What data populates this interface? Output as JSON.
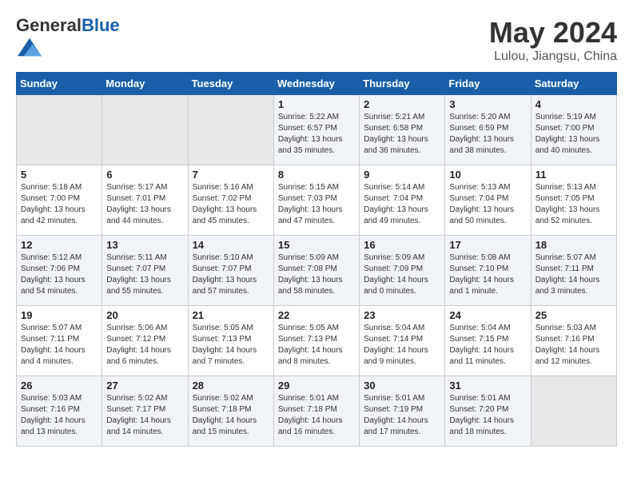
{
  "header": {
    "logo_general": "General",
    "logo_blue": "Blue",
    "month_title": "May 2024",
    "location": "Lulou, Jiangsu, China"
  },
  "weekdays": [
    "Sunday",
    "Monday",
    "Tuesday",
    "Wednesday",
    "Thursday",
    "Friday",
    "Saturday"
  ],
  "weeks": [
    [
      {
        "day": "",
        "info": ""
      },
      {
        "day": "",
        "info": ""
      },
      {
        "day": "",
        "info": ""
      },
      {
        "day": "1",
        "info": "Sunrise: 5:22 AM\nSunset: 6:57 PM\nDaylight: 13 hours\nand 35 minutes."
      },
      {
        "day": "2",
        "info": "Sunrise: 5:21 AM\nSunset: 6:58 PM\nDaylight: 13 hours\nand 36 minutes."
      },
      {
        "day": "3",
        "info": "Sunrise: 5:20 AM\nSunset: 6:59 PM\nDaylight: 13 hours\nand 38 minutes."
      },
      {
        "day": "4",
        "info": "Sunrise: 5:19 AM\nSunset: 7:00 PM\nDaylight: 13 hours\nand 40 minutes."
      }
    ],
    [
      {
        "day": "5",
        "info": "Sunrise: 5:18 AM\nSunset: 7:00 PM\nDaylight: 13 hours\nand 42 minutes."
      },
      {
        "day": "6",
        "info": "Sunrise: 5:17 AM\nSunset: 7:01 PM\nDaylight: 13 hours\nand 44 minutes."
      },
      {
        "day": "7",
        "info": "Sunrise: 5:16 AM\nSunset: 7:02 PM\nDaylight: 13 hours\nand 45 minutes."
      },
      {
        "day": "8",
        "info": "Sunrise: 5:15 AM\nSunset: 7:03 PM\nDaylight: 13 hours\nand 47 minutes."
      },
      {
        "day": "9",
        "info": "Sunrise: 5:14 AM\nSunset: 7:04 PM\nDaylight: 13 hours\nand 49 minutes."
      },
      {
        "day": "10",
        "info": "Sunrise: 5:13 AM\nSunset: 7:04 PM\nDaylight: 13 hours\nand 50 minutes."
      },
      {
        "day": "11",
        "info": "Sunrise: 5:13 AM\nSunset: 7:05 PM\nDaylight: 13 hours\nand 52 minutes."
      }
    ],
    [
      {
        "day": "12",
        "info": "Sunrise: 5:12 AM\nSunset: 7:06 PM\nDaylight: 13 hours\nand 54 minutes."
      },
      {
        "day": "13",
        "info": "Sunrise: 5:11 AM\nSunset: 7:07 PM\nDaylight: 13 hours\nand 55 minutes."
      },
      {
        "day": "14",
        "info": "Sunrise: 5:10 AM\nSunset: 7:07 PM\nDaylight: 13 hours\nand 57 minutes."
      },
      {
        "day": "15",
        "info": "Sunrise: 5:09 AM\nSunset: 7:08 PM\nDaylight: 13 hours\nand 58 minutes."
      },
      {
        "day": "16",
        "info": "Sunrise: 5:09 AM\nSunset: 7:09 PM\nDaylight: 14 hours\nand 0 minutes."
      },
      {
        "day": "17",
        "info": "Sunrise: 5:08 AM\nSunset: 7:10 PM\nDaylight: 14 hours\nand 1 minute."
      },
      {
        "day": "18",
        "info": "Sunrise: 5:07 AM\nSunset: 7:11 PM\nDaylight: 14 hours\nand 3 minutes."
      }
    ],
    [
      {
        "day": "19",
        "info": "Sunrise: 5:07 AM\nSunset: 7:11 PM\nDaylight: 14 hours\nand 4 minutes."
      },
      {
        "day": "20",
        "info": "Sunrise: 5:06 AM\nSunset: 7:12 PM\nDaylight: 14 hours\nand 6 minutes."
      },
      {
        "day": "21",
        "info": "Sunrise: 5:05 AM\nSunset: 7:13 PM\nDaylight: 14 hours\nand 7 minutes."
      },
      {
        "day": "22",
        "info": "Sunrise: 5:05 AM\nSunset: 7:13 PM\nDaylight: 14 hours\nand 8 minutes."
      },
      {
        "day": "23",
        "info": "Sunrise: 5:04 AM\nSunset: 7:14 PM\nDaylight: 14 hours\nand 9 minutes."
      },
      {
        "day": "24",
        "info": "Sunrise: 5:04 AM\nSunset: 7:15 PM\nDaylight: 14 hours\nand 11 minutes."
      },
      {
        "day": "25",
        "info": "Sunrise: 5:03 AM\nSunset: 7:16 PM\nDaylight: 14 hours\nand 12 minutes."
      }
    ],
    [
      {
        "day": "26",
        "info": "Sunrise: 5:03 AM\nSunset: 7:16 PM\nDaylight: 14 hours\nand 13 minutes."
      },
      {
        "day": "27",
        "info": "Sunrise: 5:02 AM\nSunset: 7:17 PM\nDaylight: 14 hours\nand 14 minutes."
      },
      {
        "day": "28",
        "info": "Sunrise: 5:02 AM\nSunset: 7:18 PM\nDaylight: 14 hours\nand 15 minutes."
      },
      {
        "day": "29",
        "info": "Sunrise: 5:01 AM\nSunset: 7:18 PM\nDaylight: 14 hours\nand 16 minutes."
      },
      {
        "day": "30",
        "info": "Sunrise: 5:01 AM\nSunset: 7:19 PM\nDaylight: 14 hours\nand 17 minutes."
      },
      {
        "day": "31",
        "info": "Sunrise: 5:01 AM\nSunset: 7:20 PM\nDaylight: 14 hours\nand 18 minutes."
      },
      {
        "day": "",
        "info": ""
      }
    ]
  ]
}
